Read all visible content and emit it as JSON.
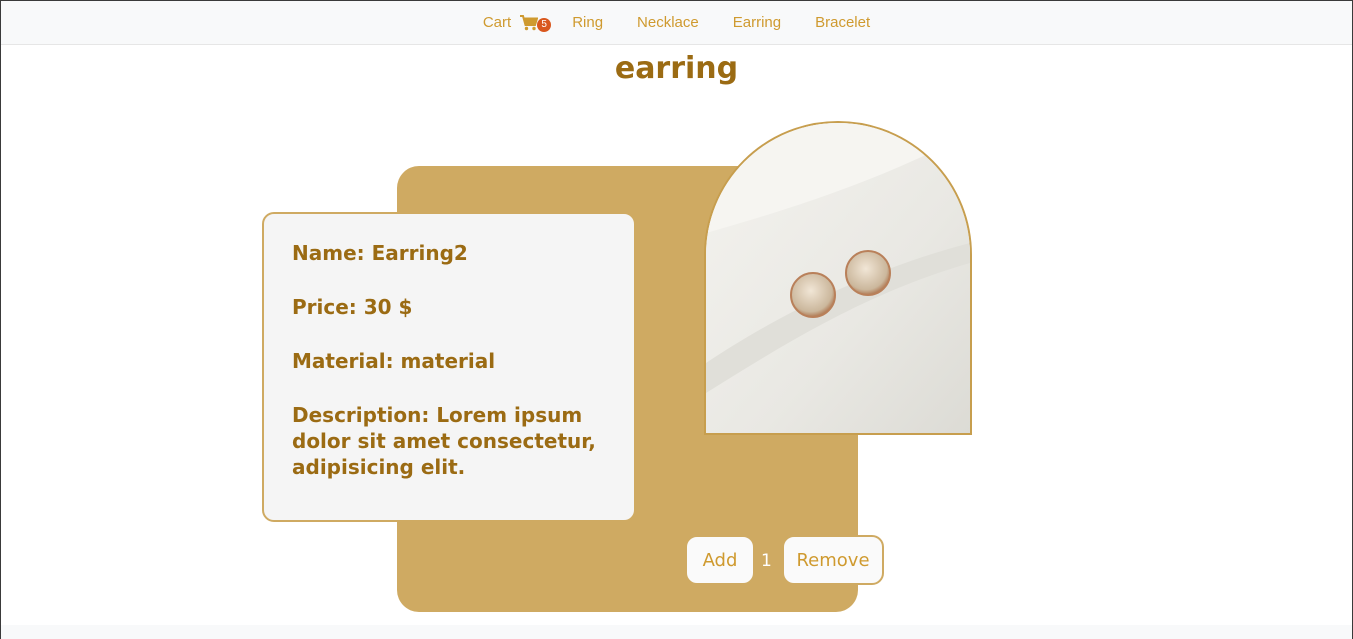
{
  "nav": {
    "cart_label": "Cart",
    "cart_count": "5",
    "links": [
      "Ring",
      "Necklace",
      "Earring",
      "Bracelet"
    ]
  },
  "page": {
    "title": "earring"
  },
  "product": {
    "name": "Name: Earring2",
    "price": "Price: 30 $",
    "material": "Material: material",
    "description": "Description: Lorem ipsum dolor sit amet consectetur, adipisicing elit."
  },
  "cart_controls": {
    "add_label": "Add",
    "quantity": "1",
    "remove_label": "Remove"
  },
  "colors": {
    "accent": "#cf9a2f",
    "title": "#9b6b13",
    "card_gold": "#cfaa62",
    "badge": "#d9571d"
  },
  "icons": {
    "cart": "cart-icon"
  }
}
